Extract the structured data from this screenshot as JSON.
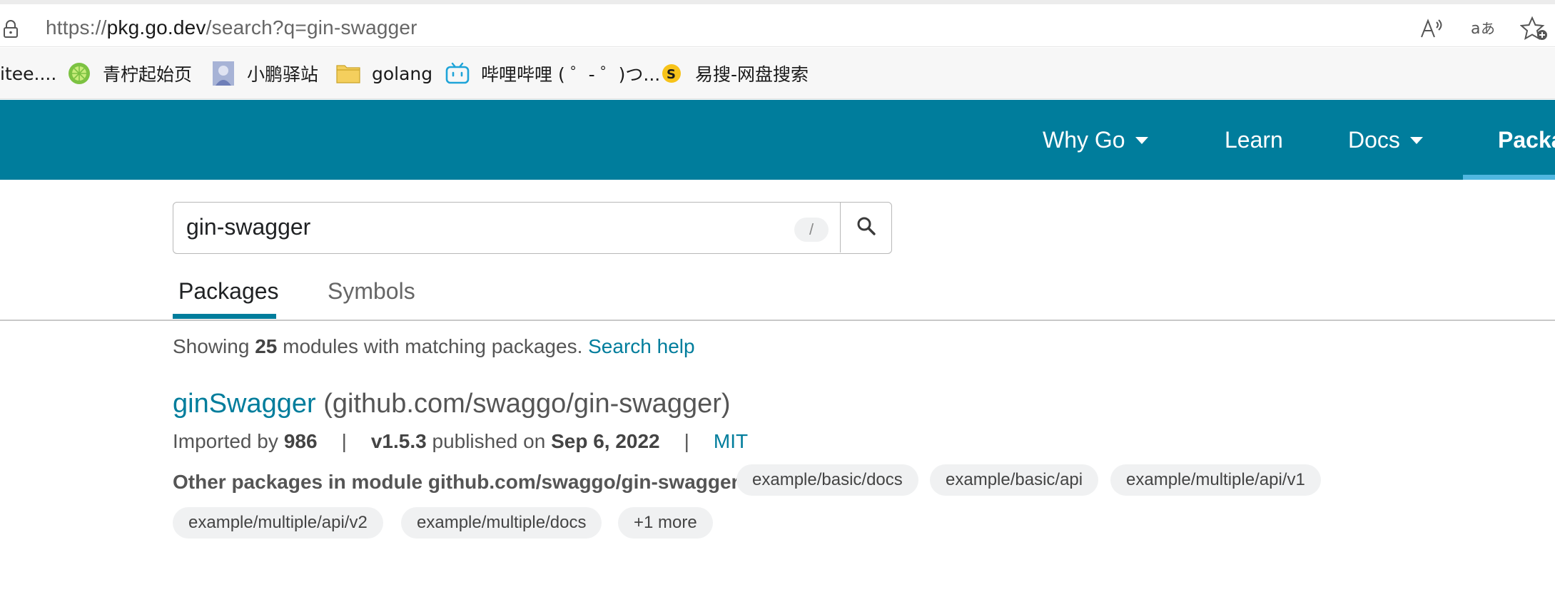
{
  "browser": {
    "url_prefix": "https://",
    "url_host": "pkg.go.dev",
    "url_path": "/search?q=gin-swagger",
    "icons": [
      "lock-icon",
      "read-aloud-icon",
      "translate-icon",
      "add-favorite-icon"
    ]
  },
  "favorites": [
    {
      "label": "itee....",
      "icon": "none"
    },
    {
      "label": "青柠起始页",
      "icon": "lime-icon"
    },
    {
      "label": "小鹏驿站",
      "icon": "avatar-icon"
    },
    {
      "label": "golang",
      "icon": "folder-icon"
    },
    {
      "label": "哔哩哔哩 ( ゜- ゜)つ...",
      "icon": "bilibili-icon"
    },
    {
      "label": "易搜-网盘搜索",
      "icon": "yisou-icon"
    }
  ],
  "header": {
    "nav": [
      {
        "label": "Why Go",
        "has_dropdown": true
      },
      {
        "label": "Learn",
        "has_dropdown": false
      },
      {
        "label": "Docs",
        "has_dropdown": true
      },
      {
        "label": "Packa",
        "has_dropdown": false,
        "active": true
      }
    ],
    "brand_color": "#007d9c"
  },
  "search": {
    "value": "gin-swagger",
    "shortcut_hint": "/",
    "icon": "search-icon"
  },
  "tabs": [
    {
      "label": "Packages",
      "active": true
    },
    {
      "label": "Symbols",
      "active": false
    }
  ],
  "summary": {
    "prefix": "Showing ",
    "count": "25",
    "suffix": " modules with matching packages. ",
    "help_link": "Search help"
  },
  "result": {
    "name": "ginSwagger",
    "module_path": " (github.com/swaggo/gin-swagger)",
    "imported_by_label": "Imported by ",
    "imported_by_count": "986",
    "separator": "|",
    "version": "v1.5.3",
    "published_label": " published on ",
    "published_date": "Sep 6, 2022",
    "license": "MIT",
    "other_packages_label": "Other packages in module github.com/swaggo/gin-swagger:",
    "other_packages": [
      "example/basic/docs",
      "example/basic/api",
      "example/multiple/api/v1",
      "example/multiple/api/v2",
      "example/multiple/docs",
      "+1 more"
    ]
  }
}
